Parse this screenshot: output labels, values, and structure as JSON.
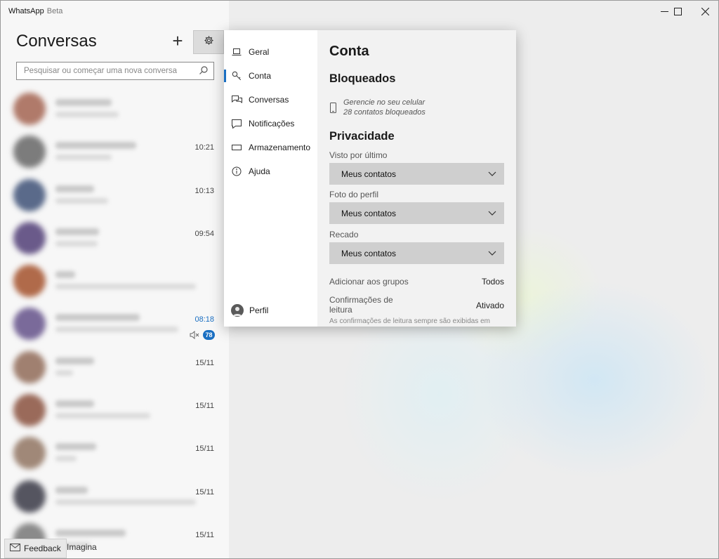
{
  "window": {
    "app_name": "WhatsApp",
    "app_suffix": "Beta",
    "controls": {
      "minimize": "─",
      "maximize": "☐",
      "close": "✕"
    }
  },
  "sidebar": {
    "title": "Conversas",
    "new_chat_symbol": "+",
    "search_placeholder": "Pesquisar ou começar uma nova conversa",
    "chats": [
      {
        "time": "",
        "avatar_color": "#b07a6a"
      },
      {
        "time": "10:21",
        "avatar_color": "#7c7c7c"
      },
      {
        "time": "10:13",
        "avatar_color": "#5a6a8a"
      },
      {
        "time": "09:54",
        "avatar_color": "#6a5a8a"
      },
      {
        "time": "",
        "avatar_color": "#b06a4a"
      },
      {
        "time": "08:18",
        "unread": true,
        "muted": true,
        "badge": "78",
        "avatar_color": "#7a6a9a"
      },
      {
        "time": "15/11",
        "avatar_color": "#a08070"
      },
      {
        "time": "15/11",
        "avatar_color": "#9a6a5a"
      },
      {
        "time": "15/11",
        "avatar_color": "#a08878"
      },
      {
        "time": "15/11",
        "avatar_color": "#555560"
      },
      {
        "time": "15/11",
        "avatar_color": "#8a8a8a"
      }
    ],
    "feedback_label": "Feedback",
    "feedback_tail": "Imagina"
  },
  "settings": {
    "nav": [
      {
        "label": "Geral",
        "icon": "laptop-icon"
      },
      {
        "label": "Conta",
        "icon": "key-icon",
        "active": true
      },
      {
        "label": "Conversas",
        "icon": "chat-icon"
      },
      {
        "label": "Notificações",
        "icon": "message-icon"
      },
      {
        "label": "Armazenamento",
        "icon": "storage-icon"
      },
      {
        "label": "Ajuda",
        "icon": "info-icon"
      }
    ],
    "profile_label": "Perfil",
    "title": "Conta",
    "blocked": {
      "heading": "Bloqueados",
      "line1": "Gerencie no seu celular",
      "line2": "28 contatos bloqueados"
    },
    "privacy": {
      "heading": "Privacidade",
      "last_seen_label": "Visto por último",
      "last_seen_value": "Meus contatos",
      "photo_label": "Foto do perfil",
      "photo_value": "Meus contatos",
      "about_label": "Recado",
      "about_value": "Meus contatos",
      "groups_label": "Adicionar aos grupos",
      "groups_value": "Todos",
      "read_receipts_label": "Confirmações de leitura",
      "read_receipts_value": "Ativado",
      "read_receipts_note": "As confirmações de leitura sempre são exibidas em"
    }
  },
  "colors": {
    "accent": "#1a6fc2",
    "select_bg": "#cfcfcf"
  }
}
